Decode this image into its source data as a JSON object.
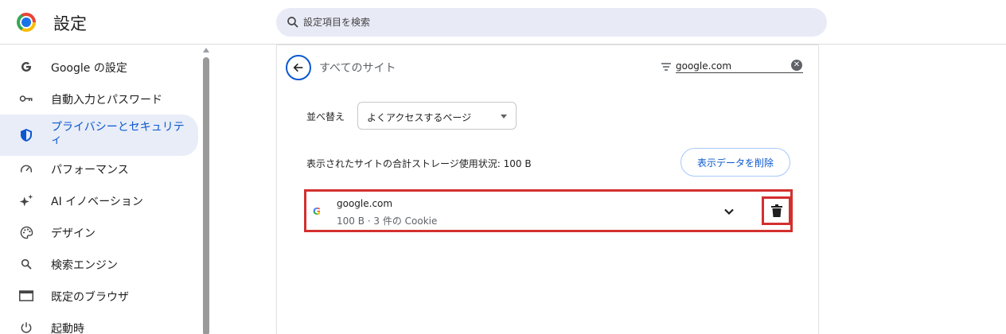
{
  "header": {
    "title": "設定",
    "search_placeholder": "設定項目を検索"
  },
  "sidebar": {
    "items": [
      {
        "label": "Google の設定",
        "icon": "google-g-icon"
      },
      {
        "label": "自動入力とパスワード",
        "icon": "key-icon"
      },
      {
        "label": "プライバシーとセキュリティ",
        "icon": "shield-icon",
        "active": true
      },
      {
        "label": "パフォーマンス",
        "icon": "speedometer-icon"
      },
      {
        "label": "AI イノベーション",
        "icon": "sparkle-icon"
      },
      {
        "label": "デザイン",
        "icon": "palette-icon"
      },
      {
        "label": "検索エンジン",
        "icon": "search-icon"
      },
      {
        "label": "既定のブラウザ",
        "icon": "browser-window-icon"
      },
      {
        "label": "起動時",
        "icon": "power-icon"
      }
    ]
  },
  "main": {
    "title": "すべてのサイト",
    "filter_value": "google.com",
    "sort_label": "並べ替え",
    "sort_value": "よくアクセスするページ",
    "storage_text": "表示されたサイトの合計ストレージ使用状況: 100 B",
    "delete_data_label": "表示データを削除",
    "site": {
      "name": "google.com",
      "detail": "100 B · 3 件の Cookie"
    }
  },
  "colors": {
    "accent": "#0b57d0",
    "highlight": "#d32f2f",
    "active_bg": "#e8edf8"
  }
}
